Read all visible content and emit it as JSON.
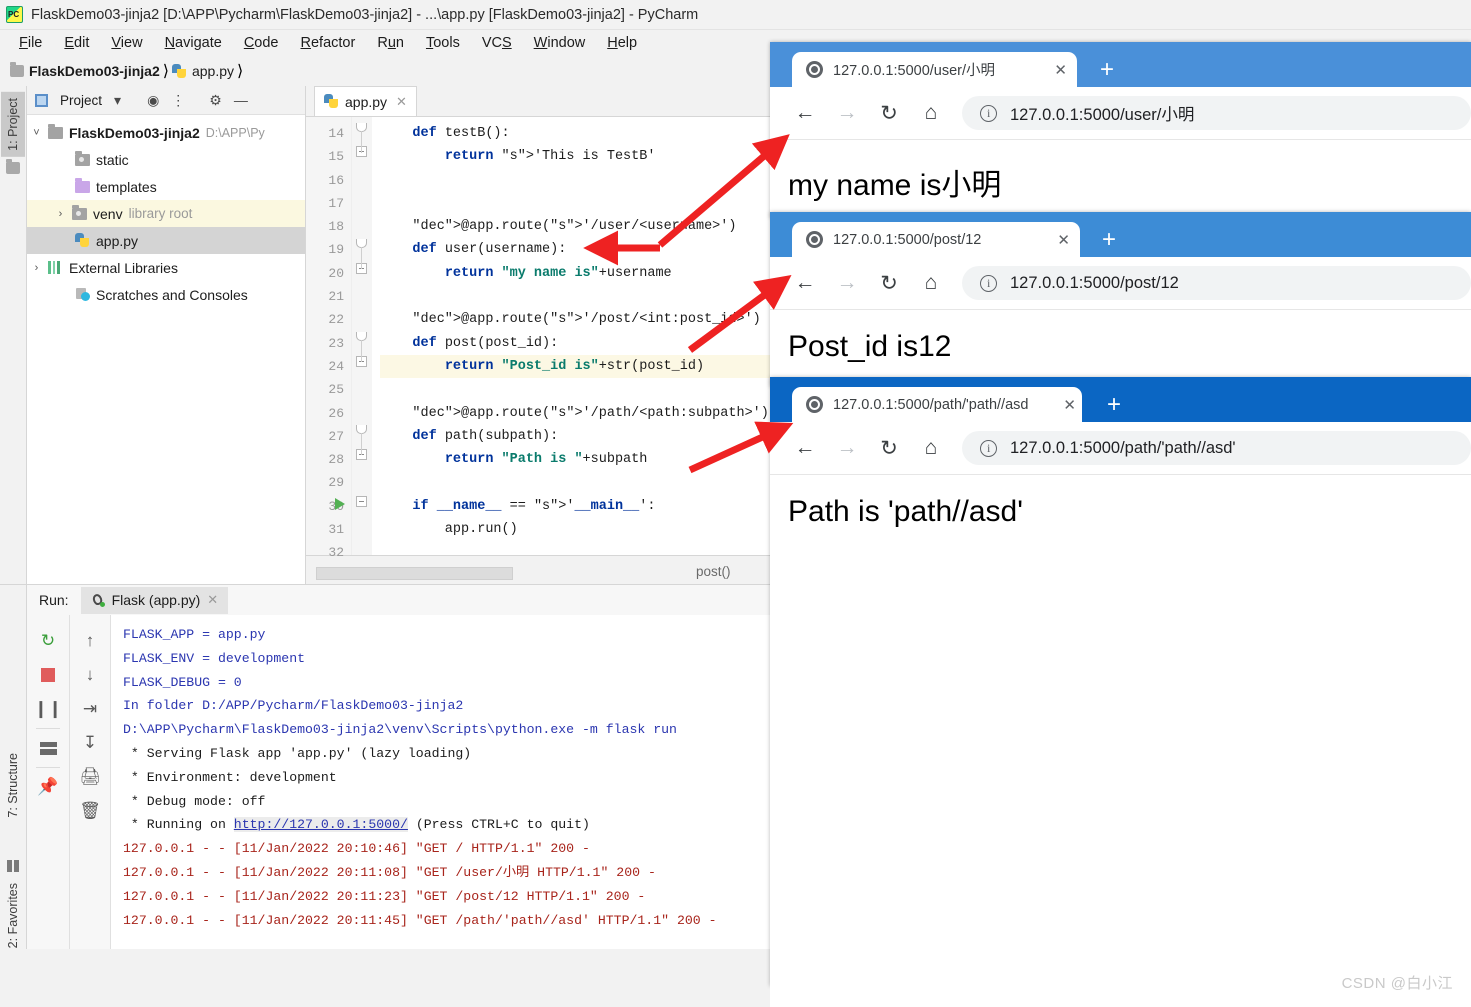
{
  "ide": {
    "window_title": "FlaskDemo03-jinja2 [D:\\APP\\Pycharm\\FlaskDemo03-jinja2] - ...\\app.py [FlaskDemo03-jinja2] - PyCharm",
    "menu": [
      {
        "label": "File"
      },
      {
        "label": "Edit"
      },
      {
        "label": "View"
      },
      {
        "label": "Navigate"
      },
      {
        "label": "Code"
      },
      {
        "label": "Refactor"
      },
      {
        "label": "Run"
      },
      {
        "label": "Tools"
      },
      {
        "label": "VCS"
      },
      {
        "label": "Window"
      },
      {
        "label": "Help"
      }
    ],
    "breadcrumb": [
      {
        "label": "FlaskDemo03-jinja2",
        "icon": "folder-icon"
      },
      {
        "label": "app.py",
        "icon": "python-file-icon"
      }
    ],
    "left_strip": [
      {
        "label": "1: Project"
      }
    ],
    "bottom_strip": [
      {
        "label": "7: Structure"
      },
      {
        "label": "2: Favorites"
      }
    ],
    "project_panel": {
      "title": "Project",
      "tree": [
        {
          "label": "FlaskDemo03-jinja2",
          "suffix": "D:\\APP\\Py",
          "arrow": "⌄",
          "icon": "folder-icon",
          "indent": 0,
          "state": "normal",
          "bold": true
        },
        {
          "label": "static",
          "suffix": "",
          "arrow": "",
          "icon": "folder-gray-icon",
          "indent": 1,
          "state": "normal",
          "bold": false
        },
        {
          "label": "templates",
          "suffix": "",
          "arrow": "",
          "icon": "folder-purple-icon",
          "indent": 1,
          "state": "normal",
          "bold": false
        },
        {
          "label": "venv",
          "suffix": "library root",
          "arrow": "›",
          "icon": "folder-gray-icon",
          "indent": 1,
          "state": "highlight",
          "bold": false
        },
        {
          "label": "app.py",
          "suffix": "",
          "arrow": "",
          "icon": "python-file-icon",
          "indent": 1,
          "state": "selected",
          "bold": false
        },
        {
          "label": "External Libraries",
          "suffix": "",
          "arrow": "›",
          "icon": "library-icon",
          "indent": 0,
          "state": "normal",
          "bold": false
        },
        {
          "label": "Scratches and Consoles",
          "suffix": "",
          "arrow": "",
          "icon": "scratch-icon",
          "indent": 0,
          "state": "normal",
          "bold": false
        }
      ]
    },
    "editor": {
      "tab_label": "app.py",
      "breadcrumb_status": "post()",
      "lines": [
        {
          "n": "14",
          "text": "    def testB():"
        },
        {
          "n": "15",
          "text": "        return 'This is TestB'"
        },
        {
          "n": "16",
          "text": ""
        },
        {
          "n": "17",
          "text": ""
        },
        {
          "n": "18",
          "text": "    @app.route('/user/<username>')"
        },
        {
          "n": "19",
          "text": "    def user(username):"
        },
        {
          "n": "20",
          "text": "        return \"my name is\"+username"
        },
        {
          "n": "21",
          "text": ""
        },
        {
          "n": "22",
          "text": "    @app.route('/post/<int:post_id>')"
        },
        {
          "n": "23",
          "text": "    def post(post_id):"
        },
        {
          "n": "24",
          "text": "        return \"Post_id is\"+str(post_id)"
        },
        {
          "n": "25",
          "text": ""
        },
        {
          "n": "26",
          "text": "    @app.route('/path/<path:subpath>')"
        },
        {
          "n": "27",
          "text": "    def path(subpath):"
        },
        {
          "n": "28",
          "text": "        return \"Path is \"+subpath"
        },
        {
          "n": "29",
          "text": ""
        },
        {
          "n": "30",
          "text": "    if __name__ == '__main__':"
        },
        {
          "n": "31",
          "text": "        app.run()"
        },
        {
          "n": "32",
          "text": ""
        }
      ]
    },
    "run_panel": {
      "run_label": "Run:",
      "tab_label": "Flask (app.py)",
      "tools_left": [
        "rerun-icon",
        "stop-icon",
        "pause-icon",
        "layout-icon",
        "pin-icon"
      ],
      "tools_right": [
        "up-icon",
        "down-icon",
        "soft-wrap-icon",
        "scroll-to-end-icon",
        "print-icon",
        "trash-icon"
      ],
      "console": [
        {
          "text": "FLASK_APP = app.py",
          "color": "blue"
        },
        {
          "text": "FLASK_ENV = development",
          "color": "blue"
        },
        {
          "text": "FLASK_DEBUG = 0",
          "color": "blue"
        },
        {
          "text": "In folder D:/APP/Pycharm/FlaskDemo03-jinja2",
          "color": "blue"
        },
        {
          "text": "D:\\APP\\Pycharm\\FlaskDemo03-jinja2\\venv\\Scripts\\python.exe -m flask run",
          "color": "blue"
        },
        {
          "text": " * Serving Flask app 'app.py' (lazy loading)",
          "color": "black"
        },
        {
          "text": " * Environment: development",
          "color": "black"
        },
        {
          "text": " * Debug mode: off",
          "color": "black"
        },
        {
          "text": " * Running on ",
          "link": "http://127.0.0.1:5000/",
          "after": " (Press CTRL+C to quit)",
          "color": "black"
        },
        {
          "text": "127.0.0.1 - - [11/Jan/2022 20:10:46] \"GET / HTTP/1.1\" 200 -",
          "color": "red"
        },
        {
          "text": "127.0.0.1 - - [11/Jan/2022 20:11:08] \"GET /user/小明 HTTP/1.1\" 200 -",
          "color": "red"
        },
        {
          "text": "127.0.0.1 - - [11/Jan/2022 20:11:23] \"GET /post/12 HTTP/1.1\" 200 -",
          "color": "red"
        },
        {
          "text": "127.0.0.1 - - [11/Jan/2022 20:11:45] \"GET /path/'path//asd' HTTP/1.1\" 200 -",
          "color": "red"
        }
      ]
    }
  },
  "browsers": [
    {
      "tab_title": "127.0.0.1:5000/user/小明",
      "url": "127.0.0.1:5000/user/小明",
      "body_text": "my name is小明",
      "new_tab_label": "+",
      "close_label": "✕",
      "frame_color": "#4a90d9"
    },
    {
      "tab_title": "127.0.0.1:5000/post/12",
      "url": "127.0.0.1:5000/post/12",
      "body_text": "Post_id is12",
      "new_tab_label": "+",
      "close_label": "✕",
      "frame_color": "#3d8cd6"
    },
    {
      "tab_title": "127.0.0.1:5000/path/'path//asd",
      "url": "127.0.0.1:5000/path/'path//asd'",
      "body_text": "Path is 'path//asd'",
      "new_tab_label": "+",
      "close_label": "✕",
      "frame_color": "#0b66c3"
    }
  ],
  "annotations": {
    "arrow_color": "#ee2222",
    "arrow_count": 3
  },
  "watermark": "CSDN @白小江"
}
